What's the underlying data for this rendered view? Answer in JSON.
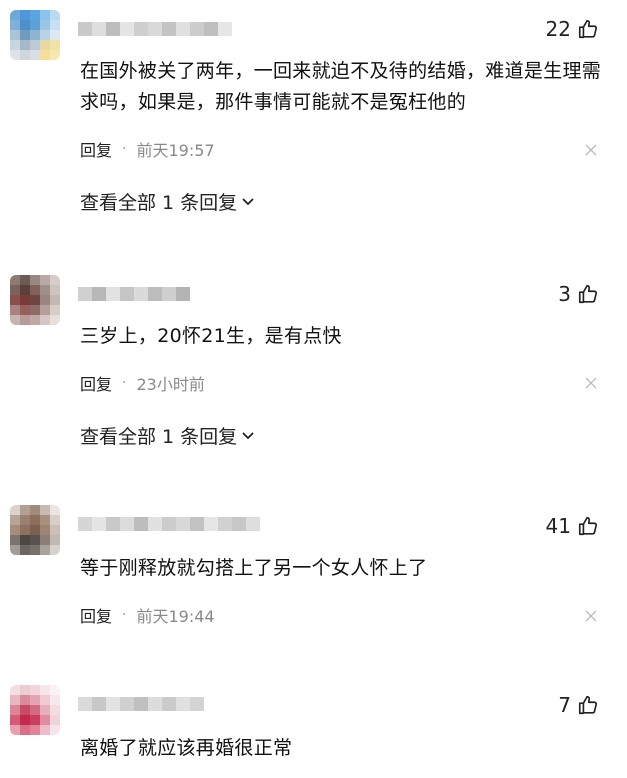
{
  "comments": [
    {
      "likes": "22",
      "text": "在国外被关了两年，一回来就迫不及待的结婚，难道是生理需求吗，如果是，那件事情可能就不是冤枉他的",
      "reply_label": "回复",
      "separator": "·",
      "time": "前天19:57",
      "view_replies": "查看全部 1 条回复"
    },
    {
      "likes": "3",
      "text": "三岁上，20怀21生，是有点快",
      "reply_label": "回复",
      "separator": "·",
      "time": "23小时前",
      "view_replies": "查看全部 1 条回复"
    },
    {
      "likes": "41",
      "text": "等于刚释放就勾搭上了另一个女人怀上了",
      "reply_label": "回复",
      "separator": "·",
      "time": "前天19:44"
    },
    {
      "likes": "7",
      "text": "离婚了就应该再婚很正常"
    }
  ],
  "colors": {
    "text": "#111111",
    "meta_gray": "#8a8a8a",
    "icon_gray": "#bbbbbb"
  },
  "icons": {
    "like": "thumbs-up-icon",
    "dismiss": "close-icon",
    "expand": "chevron-down-icon"
  }
}
